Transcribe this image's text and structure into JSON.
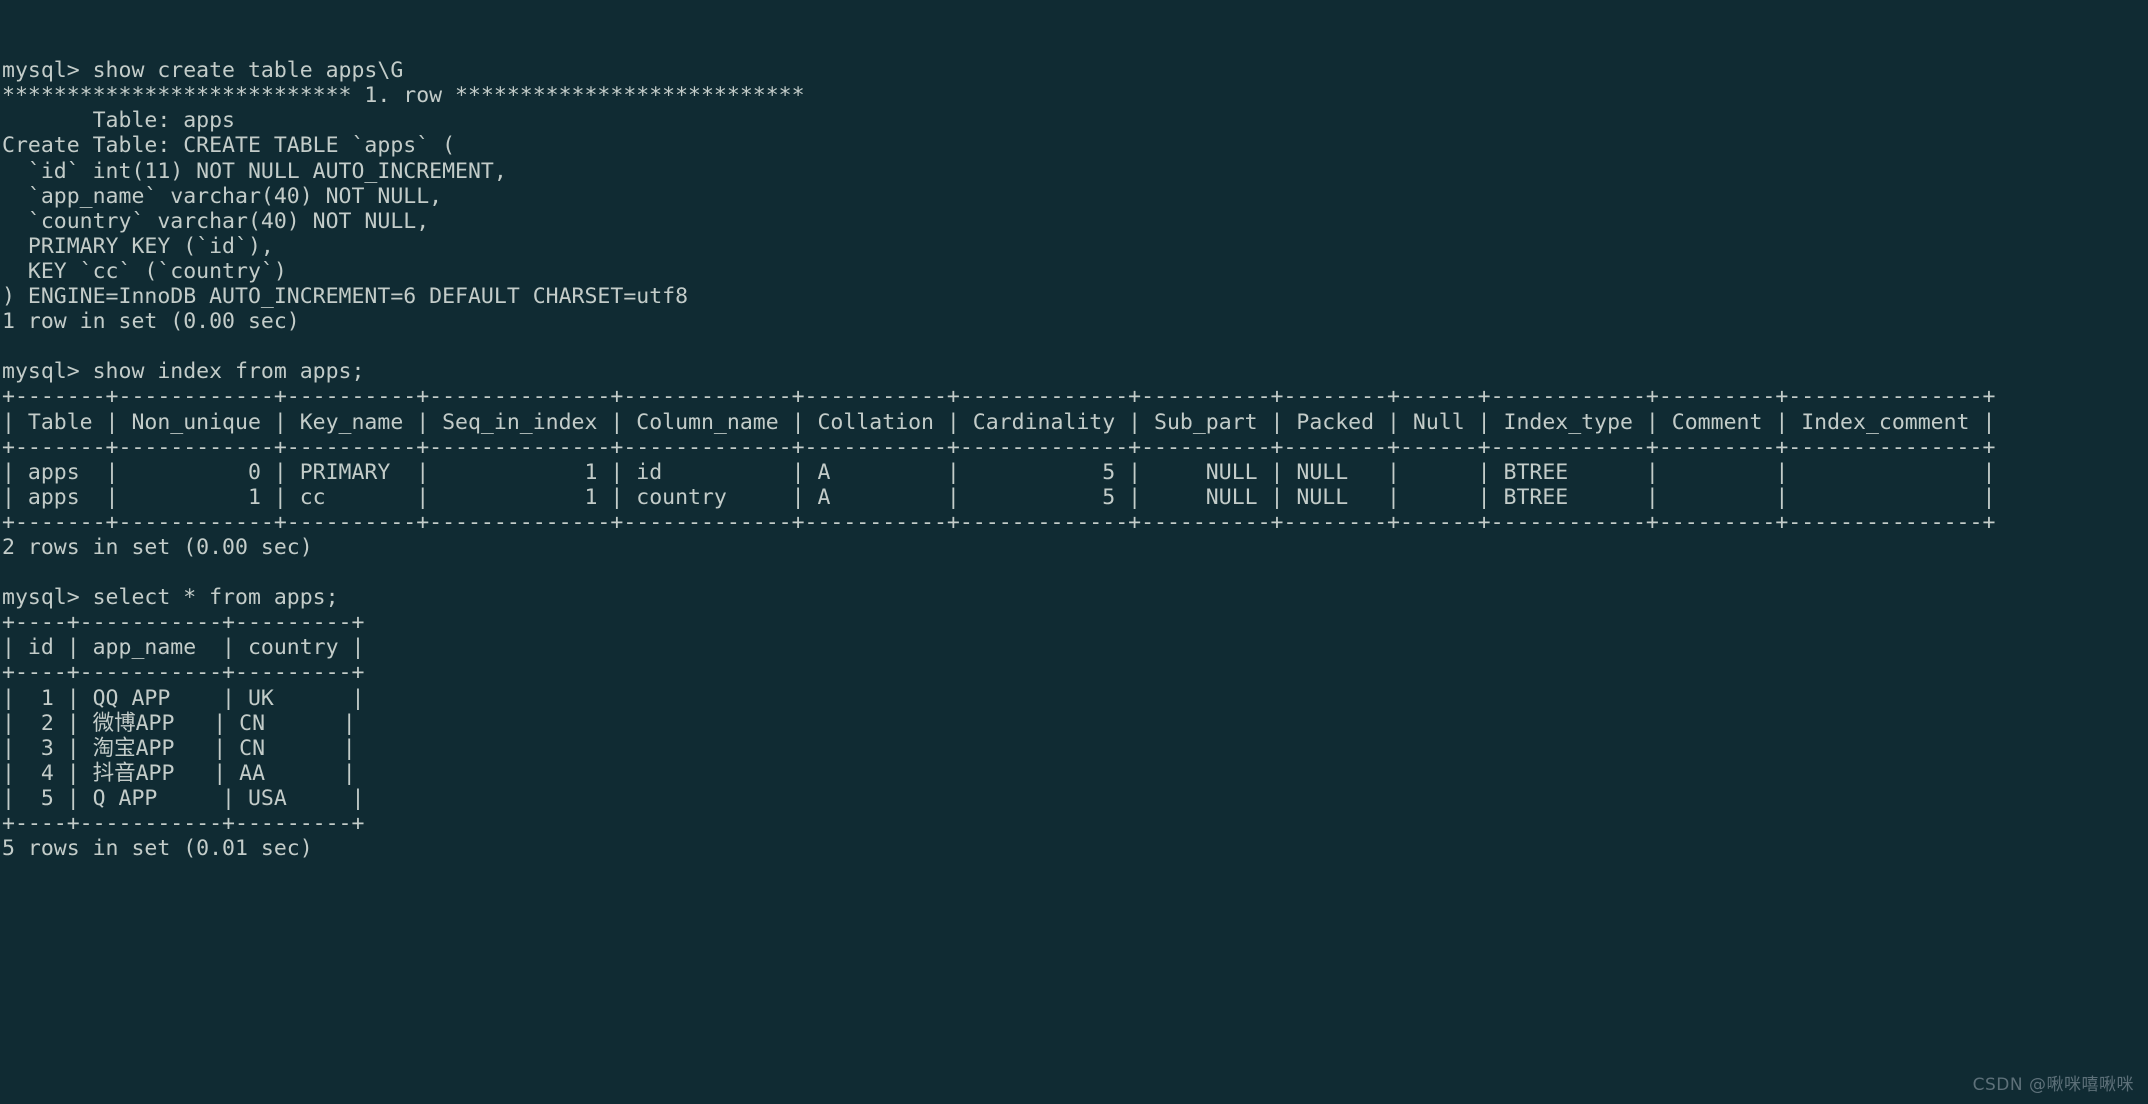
{
  "terminal": {
    "prompt": "mysql>",
    "colors": {
      "background": "#102b33",
      "foreground": "#c3ccc9",
      "watermark": "#5d7079"
    },
    "lines": [
      "mysql> show create table apps\\G",
      "*************************** 1. row ***************************",
      "       Table: apps",
      "Create Table: CREATE TABLE `apps` (",
      "  `id` int(11) NOT NULL AUTO_INCREMENT,",
      "  `app_name` varchar(40) NOT NULL,",
      "  `country` varchar(40) NOT NULL,",
      "  PRIMARY KEY (`id`),",
      "  KEY `cc` (`country`)",
      ") ENGINE=InnoDB AUTO_INCREMENT=6 DEFAULT CHARSET=utf8",
      "1 row in set (0.00 sec)",
      "",
      "mysql> show index from apps;",
      "+-------+------------+----------+--------------+-------------+-----------+-------------+----------+--------+------+------------+---------+---------------+",
      "| Table | Non_unique | Key_name | Seq_in_index | Column_name | Collation | Cardinality | Sub_part | Packed | Null | Index_type | Comment | Index_comment |",
      "+-------+------------+----------+--------------+-------------+-----------+-------------+----------+--------+------+------------+---------+---------------+",
      "| apps  |          0 | PRIMARY  |            1 | id          | A         |           5 |     NULL | NULL   |      | BTREE      |         |               |",
      "| apps  |          1 | cc       |            1 | country     | A         |           5 |     NULL | NULL   |      | BTREE      |         |               |",
      "+-------+------------+----------+--------------+-------------+-----------+-------------+----------+--------+------+------------+---------+---------------+",
      "2 rows in set (0.00 sec)",
      "",
      "mysql> select * from apps;",
      "+----+-----------+---------+",
      "| id | app_name  | country |",
      "+----+-----------+---------+",
      "|  1 | QQ APP    | UK      |",
      "|  2 | 微博APP   | CN      |",
      "|  3 | 淘宝APP   | CN      |",
      "|  4 | 抖音APP   | AA      |",
      "|  5 | Q APP     | USA     |",
      "+----+-----------+---------+",
      "5 rows in set (0.01 sec)"
    ],
    "commands": [
      "show create table apps\\G",
      "show index from apps;",
      "select * from apps;"
    ],
    "create_table": {
      "table_name": "apps",
      "statement_header": "*************************** 1. row ***************************",
      "label_table": "Table:",
      "label_create_table": "Create Table:",
      "ddl_open": "CREATE TABLE `apps` (",
      "columns": [
        "`id` int(11) NOT NULL AUTO_INCREMENT,",
        "`app_name` varchar(40) NOT NULL,",
        "`country` varchar(40) NOT NULL,",
        "PRIMARY KEY (`id`),",
        "KEY `cc` (`country`)"
      ],
      "ddl_close": ") ENGINE=InnoDB AUTO_INCREMENT=6 DEFAULT CHARSET=utf8",
      "result_status": "1 row in set (0.00 sec)"
    },
    "index_table": {
      "headers": [
        "Table",
        "Non_unique",
        "Key_name",
        "Seq_in_index",
        "Column_name",
        "Collation",
        "Cardinality",
        "Sub_part",
        "Packed",
        "Null",
        "Index_type",
        "Comment",
        "Index_comment"
      ],
      "rows": [
        [
          "apps",
          "0",
          "PRIMARY",
          "1",
          "id",
          "A",
          "5",
          "NULL",
          "NULL",
          "",
          "BTREE",
          "",
          ""
        ],
        [
          "apps",
          "1",
          "cc",
          "1",
          "country",
          "A",
          "5",
          "NULL",
          "NULL",
          "",
          "BTREE",
          "",
          ""
        ]
      ],
      "result_status": "2 rows in set (0.00 sec)"
    },
    "apps_table": {
      "headers": [
        "id",
        "app_name",
        "country"
      ],
      "rows": [
        [
          "1",
          "QQ APP",
          "UK"
        ],
        [
          "2",
          "微博APP",
          "CN"
        ],
        [
          "3",
          "淘宝APP",
          "CN"
        ],
        [
          "4",
          "抖音APP",
          "AA"
        ],
        [
          "5",
          "Q APP",
          "USA"
        ]
      ],
      "result_status": "5 rows in set (0.01 sec)"
    }
  },
  "watermark": {
    "text": "CSDN @啾咪嘻啾咪"
  }
}
